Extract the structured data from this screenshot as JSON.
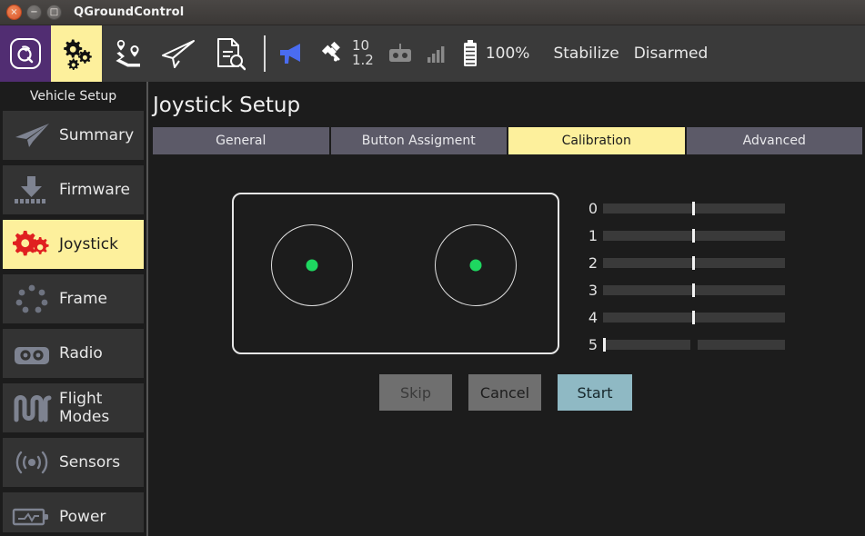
{
  "window": {
    "title": "QGroundControl",
    "controls": [
      {
        "name": "close",
        "glyph": "×"
      },
      {
        "name": "minimize",
        "glyph": "−"
      },
      {
        "name": "maximize",
        "glyph": "□"
      }
    ]
  },
  "toolbar": {
    "icons": [
      {
        "name": "qgc-logo-icon",
        "label": "QGroundControl"
      },
      {
        "name": "vehicle-setup-gears-icon",
        "label": "Vehicle Setup",
        "active": true
      },
      {
        "name": "plan-waypoints-icon",
        "label": "Plan"
      },
      {
        "name": "fly-paper-plane-icon",
        "label": "Fly"
      },
      {
        "name": "analyze-document-icon",
        "label": "Analyze"
      }
    ],
    "status": {
      "message_icon": "megaphone-icon",
      "message_color": "#4a6cf0",
      "gps_icon": "satellite-icon",
      "gps_satellites": "10",
      "gps_hdop": "1.2",
      "rc_icon": "rc-transmitter-icon",
      "signal_icon": "signal-bars-icon",
      "battery_icon": "battery-icon",
      "battery_percent": "100%",
      "flight_mode": "Stabilize",
      "arm_state": "Disarmed"
    }
  },
  "sidebar": {
    "title": "Vehicle Setup",
    "items": [
      {
        "label": "Summary",
        "icon": "paper-plane-icon",
        "selected": false
      },
      {
        "label": "Firmware",
        "icon": "download-icon",
        "selected": false
      },
      {
        "label": "Joystick",
        "icon": "gears-icon",
        "selected": true
      },
      {
        "label": "Frame",
        "icon": "frame-dots-icon",
        "selected": false
      },
      {
        "label": "Radio",
        "icon": "radio-icon",
        "selected": false
      },
      {
        "label": "Flight Modes",
        "icon": "waveform-icon",
        "selected": false
      },
      {
        "label": "Sensors",
        "icon": "sensors-icon",
        "selected": false
      },
      {
        "label": "Power",
        "icon": "power-battery-icon",
        "selected": false
      }
    ]
  },
  "main": {
    "page_title": "Joystick Setup",
    "tabs": [
      {
        "label": "General",
        "active": false
      },
      {
        "label": "Button Assigment",
        "active": false
      },
      {
        "label": "Calibration",
        "active": true
      },
      {
        "label": "Advanced",
        "active": false
      }
    ],
    "calibration": {
      "sticks": [
        {
          "name": "left-stick",
          "x_percent": 50,
          "y_percent": 50,
          "dot_color": "#1ed760"
        },
        {
          "name": "right-stick",
          "x_percent": 50,
          "y_percent": 50,
          "dot_color": "#1ed760"
        }
      ],
      "axes": [
        {
          "label": "0",
          "value_percent": 50,
          "split": false
        },
        {
          "label": "1",
          "value_percent": 50,
          "split": false
        },
        {
          "label": "2",
          "value_percent": 50,
          "split": false
        },
        {
          "label": "3",
          "value_percent": 50,
          "split": false
        },
        {
          "label": "4",
          "value_percent": 50,
          "split": false
        },
        {
          "label": "5",
          "value_percent": 0,
          "split": true
        }
      ],
      "buttons": {
        "skip": "Skip",
        "cancel": "Cancel",
        "start": "Start"
      }
    }
  },
  "colors": {
    "accent_yellow": "#fdf09c",
    "start_button": "#8fb9c4",
    "dot_green": "#1ed760",
    "logo_purple": "#512d72",
    "joystick_icon_red": "#e02020",
    "background": "#1c1c1c"
  }
}
